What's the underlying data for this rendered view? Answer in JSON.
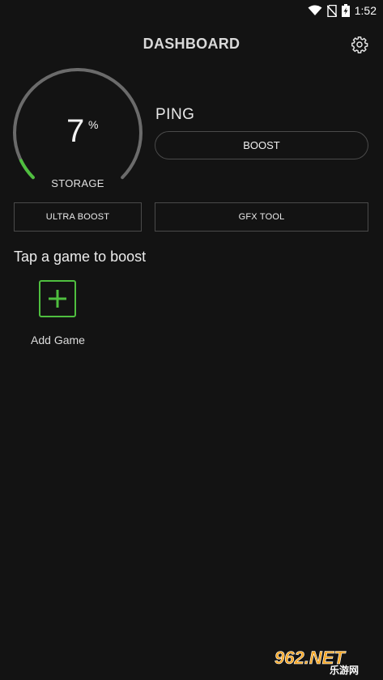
{
  "status_bar": {
    "time": "1:52",
    "icons": [
      "wifi-icon",
      "no-sim-icon",
      "battery-charging-icon"
    ]
  },
  "header": {
    "title": "DASHBOARD",
    "settings_icon": "gear-icon"
  },
  "storage_gauge": {
    "value": "7",
    "unit": "%",
    "label": "STORAGE",
    "percent": 7,
    "accent_color": "#4fbf3f",
    "track_color": "#6b6b6b"
  },
  "ping": {
    "label": "PING",
    "boost_button": "BOOST"
  },
  "actions": {
    "ultra_boost": "ULTRA BOOST",
    "gfx_tool": "GFX TOOL"
  },
  "games": {
    "section_title": "Tap a game to boost",
    "add_game_label": "Add Game",
    "add_icon": "plus-icon"
  },
  "watermark": {
    "text_main": "962.NET",
    "text_sub": "乐游网"
  }
}
